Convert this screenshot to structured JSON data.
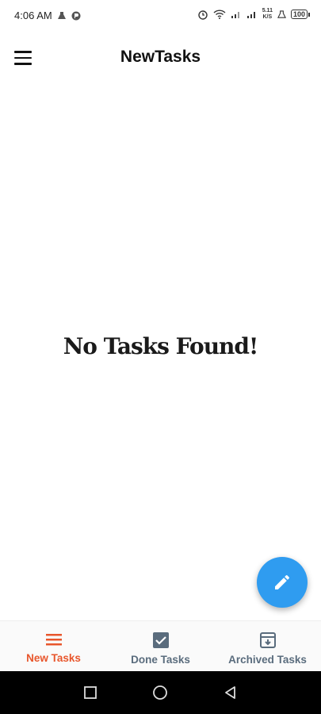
{
  "status": {
    "time": "4:06 AM",
    "net_speed": "5.11",
    "net_unit": "K/S",
    "battery": "100"
  },
  "header": {
    "title": "NewTasks",
    "menu_icon": "hamburger-menu-icon"
  },
  "main": {
    "empty_message": "No Tasks Found!"
  },
  "fab": {
    "icon": "pencil-icon",
    "color": "#2f9cf0"
  },
  "bottom_nav": {
    "items": [
      {
        "label": "New Tasks",
        "icon": "list-icon",
        "active": true
      },
      {
        "label": "Done Tasks",
        "icon": "checkbox-icon",
        "active": false
      },
      {
        "label": "Archived Tasks",
        "icon": "archive-icon",
        "active": false
      }
    ],
    "active_color": "#e8562c",
    "inactive_color": "#5a6c7d"
  },
  "system_nav": {
    "buttons": [
      "recents",
      "home",
      "back"
    ]
  }
}
